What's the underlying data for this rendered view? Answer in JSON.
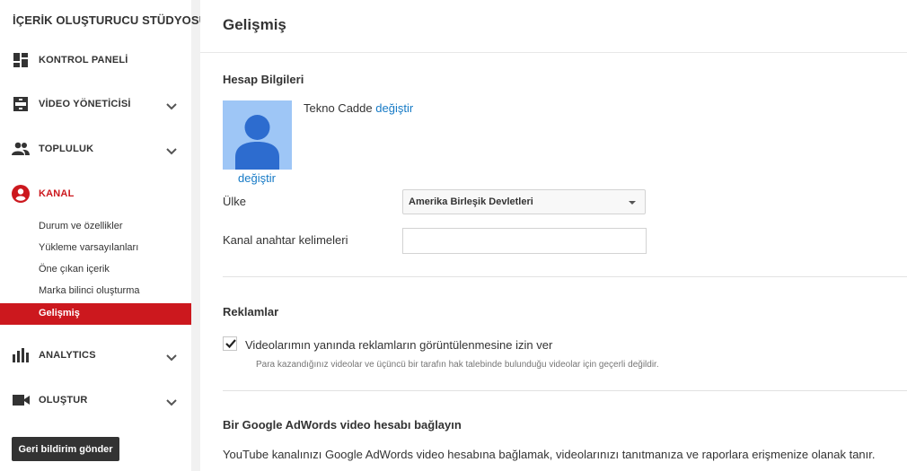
{
  "sidebar": {
    "studio_title": "İÇERİK OLUŞTURUCU STÜDYOSU",
    "items": [
      {
        "label": "KONTROL PANELİ",
        "icon": "dashboard-icon"
      },
      {
        "label": "VİDEO YÖNETİCİSİ",
        "icon": "video-manager-icon"
      },
      {
        "label": "TOPLULUK",
        "icon": "community-icon"
      },
      {
        "label": "KANAL",
        "icon": "channel-icon"
      },
      {
        "label": "ANALYTICS",
        "icon": "analytics-icon"
      },
      {
        "label": "OLUŞTUR",
        "icon": "create-icon"
      }
    ],
    "channel_subitems": [
      "Durum ve özellikler",
      "Yükleme varsayılanları",
      "Öne çıkan içerik",
      "Marka bilinci oluşturma",
      "Gelişmiş"
    ],
    "feedback_button": "Geri bildirim gönder"
  },
  "main": {
    "title": "Gelişmiş",
    "account": {
      "section_title": "Hesap Bilgileri",
      "name": "Tekno Cadde",
      "change_link": "değiştir",
      "avatar_change_link": "değiştir",
      "country_label": "Ülke",
      "country_value": "Amerika Birleşik Devletleri",
      "keywords_label": "Kanal anahtar kelimeleri",
      "keywords_value": ""
    },
    "ads": {
      "section_title": "Reklamlar",
      "checkbox_label": "Videolarımın yanında reklamların görüntülenmesine izin ver",
      "checkbox_checked": true,
      "help_text": "Para kazandığınız videolar ve üçüncü bir tarafın hak talebinde bulunduğu videolar için geçerli değildir."
    },
    "adwords": {
      "section_title": "Bir Google AdWords video hesabı bağlayın",
      "description": "YouTube kanalınızı Google AdWords video hesabına bağlamak, videolarınızı tanıtmanıza ve raporlara erişmenize olanak tanır."
    }
  },
  "colors": {
    "accent_red": "#cc181e",
    "link_blue": "#167ac6",
    "avatar_bg": "#9ec6f6",
    "avatar_figure": "#2d6ccf"
  }
}
